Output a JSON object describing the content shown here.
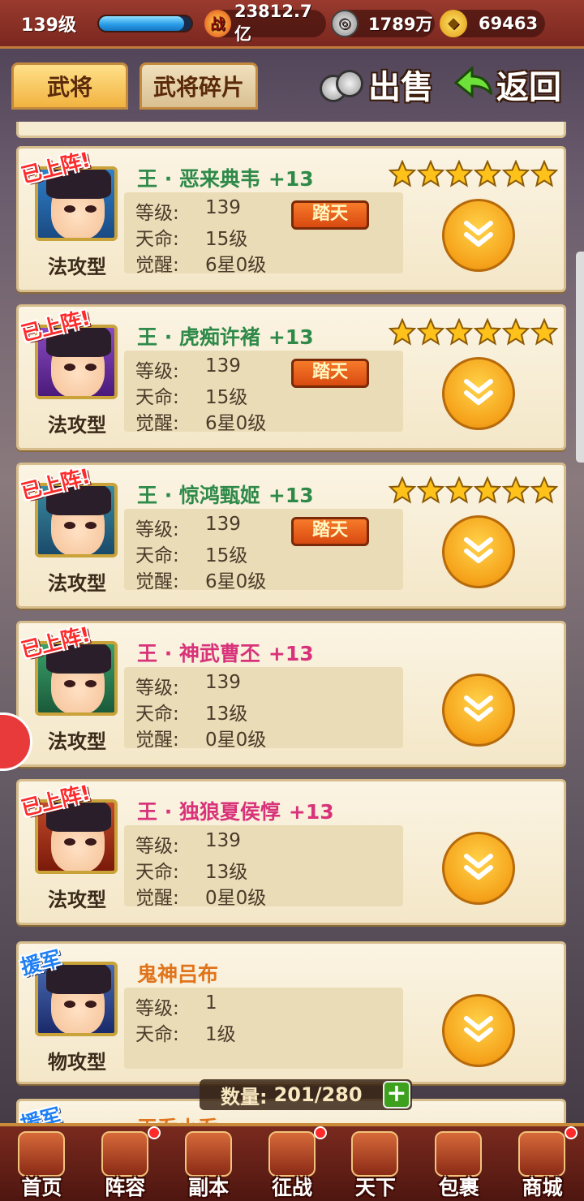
{
  "topbar": {
    "level": "139级",
    "exp_fraction": 0.92,
    "power_icon_text": "战",
    "power": "23812.7亿",
    "coins": "1789万",
    "gold": "69463"
  },
  "tabs": [
    {
      "label": "武将",
      "active": true
    },
    {
      "label": "武将碎片",
      "active": false
    }
  ],
  "actions": {
    "sell_label": "出售",
    "back_label": "返回"
  },
  "labels": {
    "level": "等级:",
    "fate": "天命:",
    "awaken": "觉醒:"
  },
  "heroes": [
    {
      "badge": "已上阵!",
      "name": "王 · 恶来典韦",
      "plus": "+13",
      "name_color": "green",
      "type": "法攻型",
      "level": "139",
      "fate": "15级",
      "awaken": "6星0级",
      "tag": "踏天",
      "stars": 6
    },
    {
      "badge": "已上阵!",
      "name": "王 · 虎痴许褚",
      "plus": "+13",
      "name_color": "green",
      "type": "法攻型",
      "level": "139",
      "fate": "15级",
      "awaken": "6星0级",
      "tag": "踏天",
      "stars": 6
    },
    {
      "badge": "已上阵!",
      "name": "王 · 惊鸿甄姬",
      "plus": "+13",
      "name_color": "green",
      "type": "法攻型",
      "level": "139",
      "fate": "15级",
      "awaken": "6星0级",
      "tag": "踏天",
      "stars": 6
    },
    {
      "badge": "已上阵!",
      "name": "王 · 神武曹丕",
      "plus": "+13",
      "name_color": "pink",
      "type": "法攻型",
      "level": "139",
      "fate": "13级",
      "awaken": "0星0级",
      "tag": "",
      "stars": 0
    },
    {
      "badge": "已上阵!",
      "name": "王 · 独狼夏侯惇",
      "plus": "+13",
      "name_color": "pink",
      "type": "法攻型",
      "level": "139",
      "fate": "13级",
      "awaken": "0星0级",
      "tag": "",
      "stars": 0
    },
    {
      "badge": "援军",
      "name": "鬼神吕布",
      "plus": "",
      "name_color": "orange",
      "type": "物攻型",
      "level": "1",
      "fate": "1级",
      "awaken": "",
      "tag": "",
      "stars": 0
    }
  ],
  "partial_card": {
    "badge": "援军",
    "name": "王乔小乔"
  },
  "count": {
    "label": "数量:",
    "value": "201/280",
    "add": "+"
  },
  "nav": [
    {
      "label": "首页",
      "icon": "home-icon",
      "dot": false
    },
    {
      "label": "阵容",
      "icon": "lineup-icon",
      "dot": true
    },
    {
      "label": "副本",
      "icon": "dungeon-icon",
      "dot": false
    },
    {
      "label": "征战",
      "icon": "battle-icon",
      "dot": true
    },
    {
      "label": "天下",
      "icon": "world-icon",
      "dot": false
    },
    {
      "label": "包裹",
      "icon": "bag-icon",
      "dot": false
    },
    {
      "label": "商城",
      "icon": "shop-icon",
      "dot": true
    }
  ],
  "colors": {
    "green_name": "#2f8a4a",
    "pink_name": "#d8337a",
    "orange_name": "#e0741c"
  }
}
